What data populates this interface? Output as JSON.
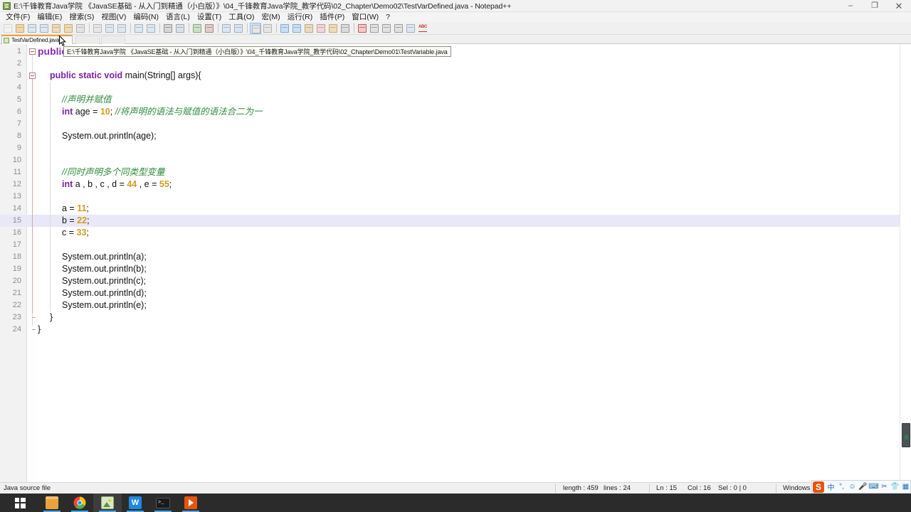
{
  "window": {
    "title": "E:\\千锋教育Java学院 《JavaSE基础 - 从入门到精通（小白版）》\\04_千锋教育Java学院_教学代码\\02_Chapter\\Demo02\\TestVarDefined.java - Notepad++",
    "app_icon": "notepad-plus-plus-icon",
    "minimize": "–",
    "maximize": "❐",
    "close": "✕"
  },
  "menu": {
    "items": [
      {
        "label": "文件(F)"
      },
      {
        "label": "编辑(E)"
      },
      {
        "label": "搜索(S)"
      },
      {
        "label": "视图(V)"
      },
      {
        "label": "编码(N)"
      },
      {
        "label": "语言(L)"
      },
      {
        "label": "设置(T)"
      },
      {
        "label": "工具(O)"
      },
      {
        "label": "宏(M)"
      },
      {
        "label": "运行(R)"
      },
      {
        "label": "插件(P)"
      },
      {
        "label": "窗口(W)"
      },
      {
        "label": "?"
      }
    ]
  },
  "toolbar": {
    "icons": [
      "new-file-icon",
      "open-file-icon",
      "save-icon",
      "save-all-icon",
      "close-file-icon",
      "close-all-icon",
      "print-icon",
      "cut-icon",
      "copy-icon",
      "paste-icon",
      "undo-icon",
      "redo-icon",
      "find-icon",
      "replace-icon",
      "zoom-in-icon",
      "zoom-out-icon",
      "sync-v-scroll-icon",
      "sync-h-scroll-icon",
      "word-wrap-icon",
      "show-all-chars-icon",
      "indent-guide-icon",
      "ui-doc-map-icon",
      "function-list-icon",
      "doc-switcher-icon",
      "folder-workspace-icon",
      "monitor-icon",
      "record-macro-icon",
      "stop-macro-icon",
      "play-macro-icon",
      "play-multi-macro-icon",
      "save-macro-icon",
      "spell-check-icon"
    ]
  },
  "tabs": {
    "active": "TestVarDefined.java",
    "items": [
      {
        "label": "TestVarDefined.java",
        "icon": "java-file-icon",
        "modified": false
      }
    ],
    "close_button": "✕"
  },
  "tooltip": {
    "visible": true,
    "text": "E:\\千锋教育Java学院 《JavaSE基础 - 从入门到精通（小白版）》\\04_千锋教育Java学院_教学代码\\02_Chapter\\Demo01\\TestVariable.java"
  },
  "editor": {
    "language": "Java",
    "current_line": 15,
    "total_lines": 24,
    "lines": [
      {
        "n": 1,
        "indent": 0,
        "fold": "open-root",
        "tokens": [
          {
            "t": "public",
            "c": "kw2 big1"
          }
        ]
      },
      {
        "n": 2,
        "indent": 0,
        "tokens": []
      },
      {
        "n": 3,
        "indent": 1,
        "fold": "open",
        "tokens": [
          {
            "t": "public static void ",
            "c": "kw"
          },
          {
            "t": "main(String[] args){",
            "c": "plain"
          }
        ]
      },
      {
        "n": 4,
        "indent": 1,
        "tokens": []
      },
      {
        "n": 5,
        "indent": 2,
        "tokens": [
          {
            "t": "//声明并赋值",
            "c": "cmt"
          }
        ]
      },
      {
        "n": 6,
        "indent": 2,
        "tokens": [
          {
            "t": "int ",
            "c": "kw"
          },
          {
            "t": "age = ",
            "c": "plain"
          },
          {
            "t": "10",
            "c": "num"
          },
          {
            "t": "; ",
            "c": "plain"
          },
          {
            "t": "//将声明的语法与赋值的语法合二为一",
            "c": "cmt"
          }
        ]
      },
      {
        "n": 7,
        "indent": 2,
        "tokens": []
      },
      {
        "n": 8,
        "indent": 2,
        "tokens": [
          {
            "t": "System.out.println(age);",
            "c": "plain"
          }
        ]
      },
      {
        "n": 9,
        "indent": 2,
        "tokens": []
      },
      {
        "n": 10,
        "indent": 2,
        "tokens": []
      },
      {
        "n": 11,
        "indent": 2,
        "tokens": [
          {
            "t": "//同时声明多个同类型变量",
            "c": "cmt"
          }
        ]
      },
      {
        "n": 12,
        "indent": 2,
        "tokens": [
          {
            "t": "int ",
            "c": "kw"
          },
          {
            "t": "a , b , c , d = ",
            "c": "plain"
          },
          {
            "t": "44",
            "c": "num"
          },
          {
            "t": " , e = ",
            "c": "plain"
          },
          {
            "t": "55",
            "c": "num"
          },
          {
            "t": ";",
            "c": "plain"
          }
        ]
      },
      {
        "n": 13,
        "indent": 2,
        "tokens": []
      },
      {
        "n": 14,
        "indent": 2,
        "tokens": [
          {
            "t": "a = ",
            "c": "plain"
          },
          {
            "t": "11",
            "c": "num"
          },
          {
            "t": ";",
            "c": "plain"
          }
        ]
      },
      {
        "n": 15,
        "indent": 2,
        "highlight": true,
        "tokens": [
          {
            "t": "b = ",
            "c": "plain"
          },
          {
            "t": "22",
            "c": "num"
          },
          {
            "t": ";",
            "c": "plain"
          }
        ]
      },
      {
        "n": 16,
        "indent": 2,
        "tokens": [
          {
            "t": "c = ",
            "c": "plain"
          },
          {
            "t": "33",
            "c": "num"
          },
          {
            "t": ";",
            "c": "plain"
          }
        ]
      },
      {
        "n": 17,
        "indent": 2,
        "tokens": []
      },
      {
        "n": 18,
        "indent": 2,
        "tokens": [
          {
            "t": "System.out.println(a);",
            "c": "plain"
          }
        ]
      },
      {
        "n": 19,
        "indent": 2,
        "tokens": [
          {
            "t": "System.out.println(b);",
            "c": "plain"
          }
        ]
      },
      {
        "n": 20,
        "indent": 2,
        "tokens": [
          {
            "t": "System.out.println(c);",
            "c": "plain"
          }
        ]
      },
      {
        "n": 21,
        "indent": 2,
        "tokens": [
          {
            "t": "System.out.println(d);",
            "c": "plain"
          }
        ]
      },
      {
        "n": 22,
        "indent": 2,
        "tokens": [
          {
            "t": "System.out.println(e);",
            "c": "plain"
          }
        ]
      },
      {
        "n": 23,
        "indent": 1,
        "fold": "end",
        "tokens": [
          {
            "t": "}",
            "c": "plain"
          }
        ]
      },
      {
        "n": 24,
        "indent": 0,
        "fold": "end-root",
        "tokens": [
          {
            "t": "}",
            "c": "plain"
          }
        ]
      }
    ]
  },
  "statusbar": {
    "file_type": "Java source file",
    "length_label": "length : 459",
    "lines_label": "lines : 24",
    "ln_label": "Ln : 15",
    "col_label": "Col : 16",
    "sel_label": "Sel : 0 | 0",
    "eol_label": "Windows (C",
    "encoding_label": "",
    "insert_label": ""
  },
  "ime": {
    "logo": "S",
    "items": [
      "中",
      "°,",
      "☺",
      "🎤",
      "⌨",
      "✂",
      "👕",
      "▦"
    ]
  },
  "taskbar": {
    "start": "windows-start-icon",
    "items": [
      {
        "name": "file-explorer-icon",
        "color": "#e8a33d",
        "running": true,
        "active": false
      },
      {
        "name": "chrome-icon",
        "color": "#4caf50",
        "running": true,
        "active": false
      },
      {
        "name": "photos-icon",
        "color": "#8bc34a",
        "running": true,
        "active": true
      },
      {
        "name": "wps-icon",
        "color": "#1e88e5",
        "running": true,
        "active": false
      },
      {
        "name": "terminal-icon",
        "color": "#2b2b2b",
        "running": true,
        "active": false
      },
      {
        "name": "presentation-icon",
        "color": "#e8540a",
        "running": true,
        "active": false
      }
    ]
  },
  "colors": {
    "accent": "#e8a33d",
    "keyword": "#7b1fa2",
    "number": "#d79b1e",
    "comment": "#2e8b3d",
    "highlight_line": "#e8e8f8",
    "taskbar_bg": "#2b2b2b"
  }
}
